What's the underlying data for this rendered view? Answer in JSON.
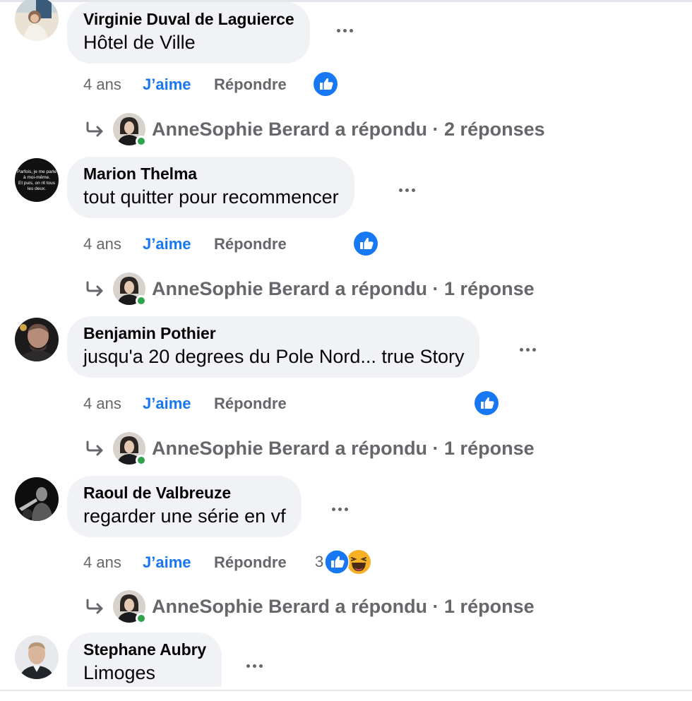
{
  "comments": [
    {
      "author": "Virginie Duval de Laguierce",
      "text": "Hôtel de Ville",
      "time": "4 ans",
      "like_label": "J’aime",
      "reply_label": "Répondre",
      "reaction_count": "",
      "replies": "AnneSophie Berard a répondu · 2 réponses"
    },
    {
      "author": "Marion Thelma",
      "text": "tout quitter pour recommencer",
      "avatar_quote": "Parfois, je me parle à moi-même. Et puis, on rit tous les deux.",
      "time": "4 ans",
      "like_label": "J’aime",
      "reply_label": "Répondre",
      "reaction_count": "",
      "replies": "AnneSophie Berard a répondu · 1 réponse"
    },
    {
      "author": "Benjamin Pothier",
      "text": "jusqu'a 20 degrees du Pole Nord... true Story",
      "time": "4 ans",
      "like_label": "J’aime",
      "reply_label": "Répondre",
      "reaction_count": "",
      "replies": "AnneSophie Berard a répondu · 1 réponse"
    },
    {
      "author": "Raoul de Valbreuze",
      "text": "regarder une série en vf",
      "time": "4 ans",
      "like_label": "J’aime",
      "reply_label": "Répondre",
      "reaction_count": "3",
      "replies": "AnneSophie Berard a répondu · 1 réponse"
    },
    {
      "author": "Stephane Aubry",
      "text": "Limoges"
    }
  ],
  "colors": {
    "link_blue": "#1877f2",
    "secondary_text": "#65676b",
    "bubble_bg": "#f0f2f5",
    "online_green": "#31a24c",
    "haha_yellow": "#f7b125"
  },
  "icons": {
    "more": "more-horizontal-icon",
    "like_reaction": "thumbs-up-icon",
    "haha_reaction": "laughing-face-icon",
    "reply_arrow": "reply-arrow-icon"
  }
}
